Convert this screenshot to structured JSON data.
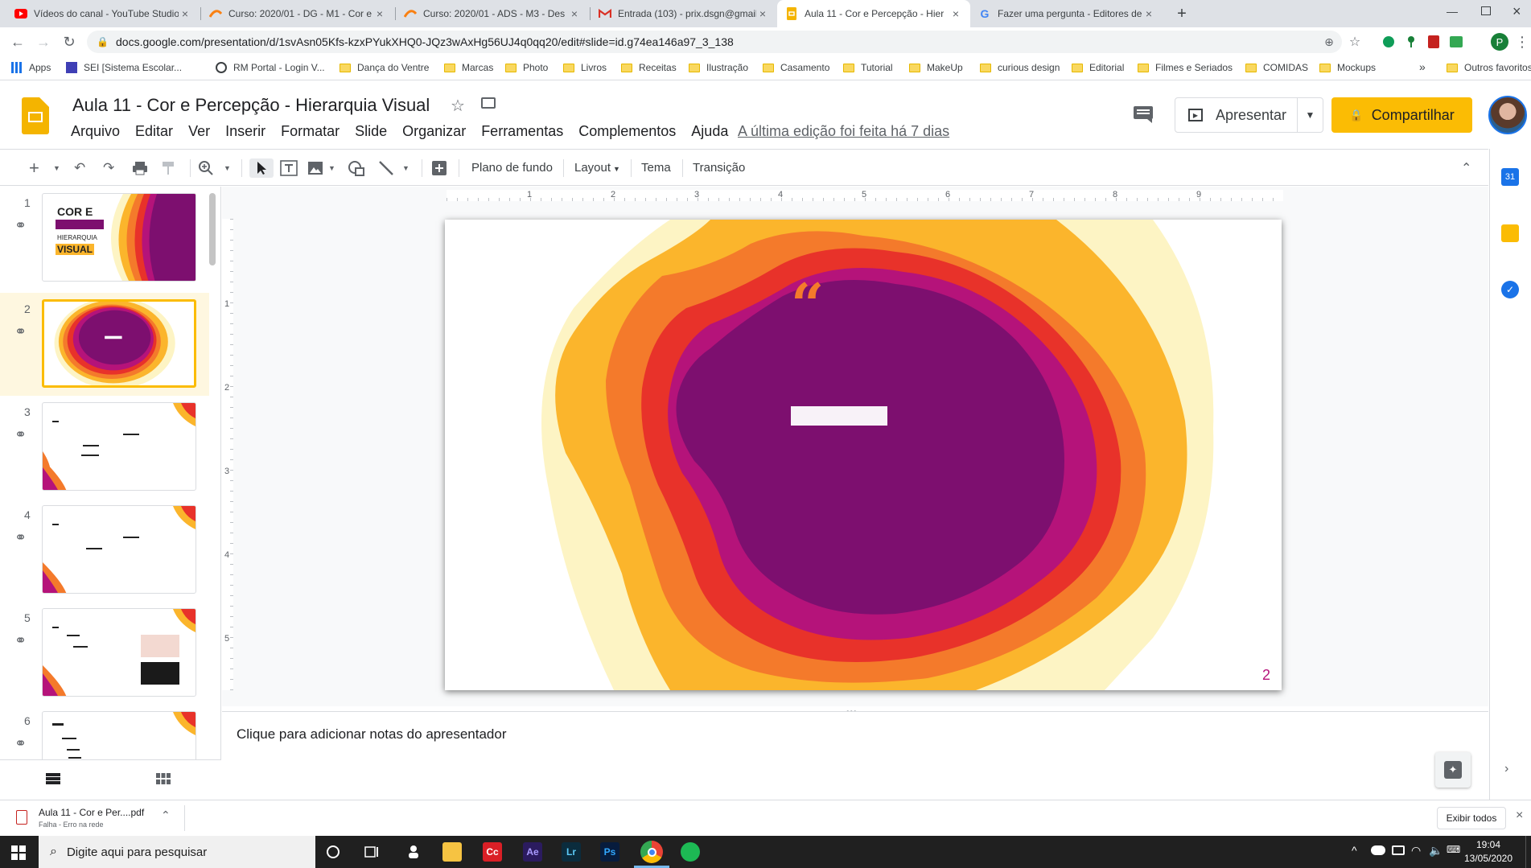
{
  "browser": {
    "tabs": [
      {
        "title": "Vídeos do canal - YouTube Studio",
        "icon": "youtube-icon",
        "color": "#ff0000"
      },
      {
        "title": "Curso: 2020/01 - DG - M1 - Cor e",
        "icon": "moodle-icon",
        "color": "#f98012"
      },
      {
        "title": "Curso: 2020/01 - ADS - M3 - Des",
        "icon": "moodle-icon",
        "color": "#f98012"
      },
      {
        "title": "Entrada (103) - prix.dsgn@gmail",
        "icon": "gmail-icon",
        "color": "#d93025"
      },
      {
        "title": "Aula 11 - Cor e Percepção - Hier",
        "icon": "slides-icon",
        "color": "#f4b400"
      },
      {
        "title": "Fazer uma pergunta - Editores de",
        "icon": "google-icon",
        "color": "#4285f4"
      }
    ],
    "new_tab": "+",
    "url": "docs.google.com/presentation/d/1svAsn05Kfs-kzxPYukXHQ0-JQz3wAxHg56UJ4q0qq20/edit#slide=id.g74ea146a97_3_138",
    "profile_initial": "P",
    "bookmarks": [
      "Apps",
      "SEI [Sistema Escolar...",
      "RM Portal - Login V...",
      "Dança do Ventre",
      "Marcas",
      "Photo",
      "Livros",
      "Receitas",
      "Ilustração",
      "Casamento",
      "Tutorial",
      "MakeUp",
      "curious design",
      "Editorial",
      "Filmes e Seriados",
      "COMIDAS",
      "Mockups"
    ],
    "bookmarks_more": "»",
    "other_bookmarks": "Outros favoritos"
  },
  "docs": {
    "title": "Aula 11 - Cor e Percepção - Hierarquia Visual",
    "menu": [
      "Arquivo",
      "Editar",
      "Ver",
      "Inserir",
      "Formatar",
      "Slide",
      "Organizar",
      "Ferramentas",
      "Complementos",
      "Ajuda"
    ],
    "last_edit": "A última edição foi feita há 7 dias",
    "present_label": "Apresentar",
    "share_label": "Compartilhar"
  },
  "toolbar": {
    "background": "Plano de fundo",
    "layout": "Layout",
    "theme": "Tema",
    "transition": "Transição"
  },
  "ruler": {
    "h_numbers": [
      "1",
      "2",
      "3",
      "4",
      "5",
      "6",
      "7",
      "8",
      "9"
    ],
    "v_numbers": [
      "1",
      "2",
      "3",
      "4",
      "5"
    ]
  },
  "filmstrip": {
    "slides": [
      {
        "number": "1",
        "title_line1": "COR E",
        "title_line3": "HIERARQUIA",
        "title_line4": "VISUAL"
      },
      {
        "number": "2"
      },
      {
        "number": "3"
      },
      {
        "number": "4"
      },
      {
        "number": "5"
      },
      {
        "number": "6"
      }
    ]
  },
  "slide": {
    "quote_mark": "“",
    "page_number": "2",
    "colors": {
      "purple": "#7d0f6f",
      "magenta": "#b5137a",
      "red": "#e8322a",
      "orange": "#f47a2b",
      "gold": "#fbb52c",
      "cream": "#fdf4c4"
    }
  },
  "notes": {
    "text": "Clique para adicionar notas do apresentador"
  },
  "downloads": {
    "filename": "Aula 11 - Cor e Per....pdf",
    "status": "Falha - Erro na rede",
    "show_all": "Exibir todos"
  },
  "taskbar": {
    "search_placeholder": "Digite aqui para pesquisar",
    "time": "19:04",
    "date": "13/05/2020"
  }
}
